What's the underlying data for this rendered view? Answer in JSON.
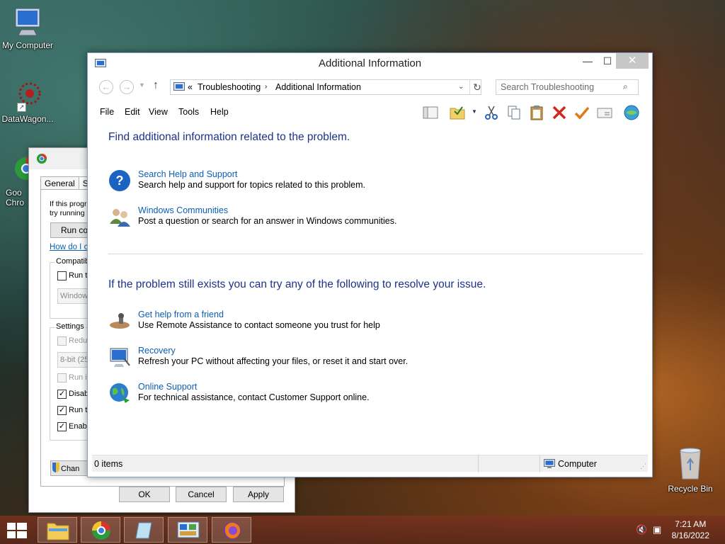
{
  "desktop": {
    "icons": {
      "my_computer": "My Computer",
      "datawagon": "DataWagon...",
      "chrome_line1": "Goo",
      "chrome_line2": "Chro",
      "recycle_bin": "Recycle Bin"
    }
  },
  "bg_window": {
    "tabs": [
      "General",
      "Sh"
    ],
    "intro_line1": "If this progr",
    "intro_line2": "try running t",
    "run_button": "Run cor",
    "help_link": "How do I cl",
    "compat_group": "Compatib",
    "run_this": "Run th",
    "windows_combo": "Windows",
    "settings_group": "Settings",
    "reduced": "Reduc",
    "color_combo": "8-bit (256",
    "run_in": "Run in",
    "disable": "Disabl",
    "run_this2": "Run th",
    "enable": "Enabl",
    "change_button": "Chan",
    "ok": "OK",
    "cancel": "Cancel",
    "apply": "Apply"
  },
  "main_window": {
    "title": "Additional Information",
    "address": {
      "prefix": "«",
      "crumb1": "Troubleshooting",
      "crumb2": "Additional Information"
    },
    "search_placeholder": "Search Troubleshooting",
    "menu": [
      "File",
      "Edit",
      "View",
      "Tools",
      "Help"
    ],
    "heading1": "Find additional information related to the problem.",
    "heading2": "If the problem still exists you can try any of the following to resolve your issue.",
    "tasks1": [
      {
        "icon": "help-question-icon",
        "link": "Search Help and Support",
        "desc": "Search help and support for topics related to this problem."
      },
      {
        "icon": "users-icon",
        "link": "Windows Communities",
        "desc": "Post a question or search for an answer in Windows communities."
      }
    ],
    "tasks2": [
      {
        "icon": "remote-assistance-icon",
        "link": "Get help from a friend",
        "desc": "Use Remote Assistance to contact someone you trust for help"
      },
      {
        "icon": "recovery-icon",
        "link": "Recovery",
        "desc": "Refresh your PC without affecting your files, or reset it and start over."
      },
      {
        "icon": "globe-icon",
        "link": "Online Support",
        "desc": "For technical assistance, contact Customer Support online."
      }
    ],
    "status": {
      "items": "0 items",
      "zone": "Computer"
    }
  },
  "taskbar": {
    "time": "7:21 AM",
    "date": "8/16/2022"
  },
  "colors": {
    "heading": "#1e3287",
    "link": "#0a5fb4"
  }
}
